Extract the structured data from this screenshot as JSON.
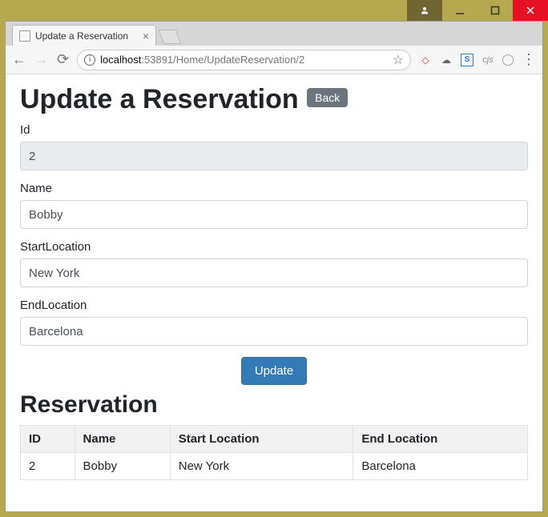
{
  "window": {
    "tab_title": "Update a Reservation",
    "url_host": "localhost",
    "url_port": ":53891",
    "url_path": "/Home/UpdateReservation/2"
  },
  "page": {
    "heading": "Update a Reservation",
    "back_label": "Back",
    "form": {
      "id": {
        "label": "Id",
        "value": "2"
      },
      "name": {
        "label": "Name",
        "value": "Bobby"
      },
      "start": {
        "label": "StartLocation",
        "value": "New York"
      },
      "end": {
        "label": "EndLocation",
        "value": "Barcelona"
      }
    },
    "submit_label": "Update",
    "table_heading": "Reservation",
    "table": {
      "headers": {
        "id": "ID",
        "name": "Name",
        "start": "Start Location",
        "end": "End Location"
      },
      "row": {
        "id": "2",
        "name": "Bobby",
        "start": "New York",
        "end": "Barcelona"
      }
    }
  },
  "ext": {
    "cjs": "cjs",
    "s": "S"
  }
}
